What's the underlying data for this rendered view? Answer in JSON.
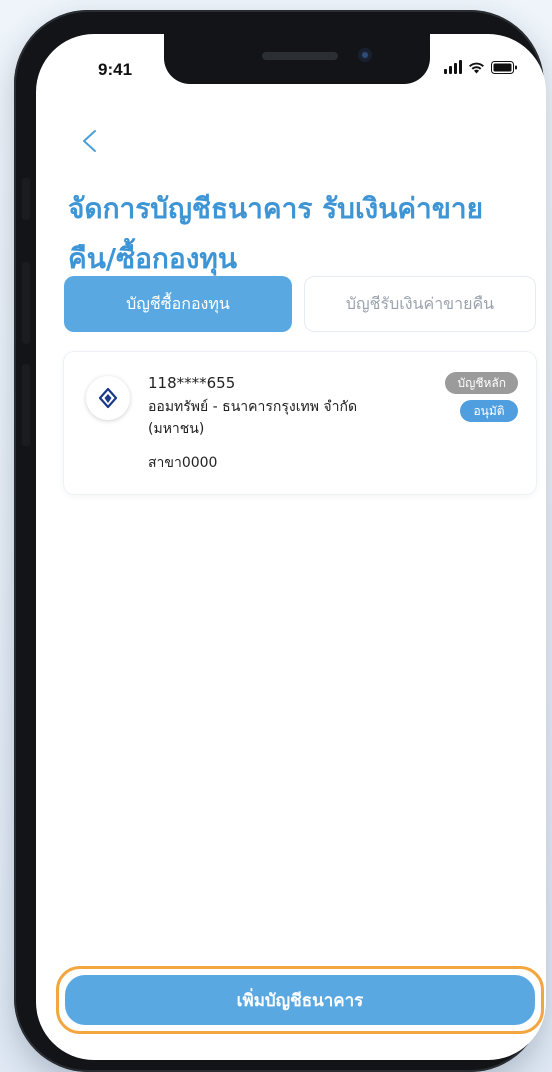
{
  "status_bar": {
    "time": "9:41"
  },
  "header": {
    "back_icon": "chevron-left-icon",
    "title": "จัดการบัญชีธนาคาร รับเงินค่าขายคืน/ซื้อกองทุน"
  },
  "tabs": [
    {
      "label": "บัญชีซื้อกองทุน",
      "active": true
    },
    {
      "label": "บัญชีรับเงินค่าขายคืน",
      "active": false
    }
  ],
  "account": {
    "bank_icon": "bangkok-bank-lotus-icon",
    "number": "118****655",
    "description": "ออมทรัพย์ - ธนาคารกรุงเทพ จำกัด (มหาชน)",
    "branch": "สาขา0000",
    "badges": {
      "primary": "บัญชีหลัก",
      "status": "อนุมัติ"
    }
  },
  "actions": {
    "add_bank_account": "เพิ่มบัญชีธนาคาร"
  },
  "colors": {
    "accent": "#3d95d6",
    "tab_active": "#5aa8e2",
    "badge_primary": "#9b9b9b",
    "badge_approved": "#4f9fe0",
    "highlight_outline": "#f3a640"
  }
}
